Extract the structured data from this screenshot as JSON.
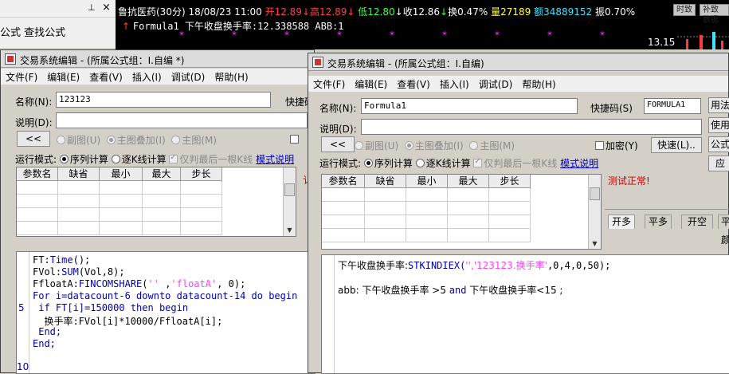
{
  "bg": {
    "menu_text": "公式 查找公式",
    "pin_icon": "pin-icon",
    "close_icon": "close-icon"
  },
  "stock": {
    "name_period": "鲁抗医药(30分)",
    "datetime": "18/08/23 11:00",
    "open": "开12.89",
    "high": "高12.89",
    "low": "低12.80",
    "close": "收12.86",
    "turnover": "换0.47%",
    "volume": "量27189",
    "amount": "额34889152",
    "amplitude": "振0.70%",
    "formula_line": "Formula1 下午收盘换手率:12.338588 ABB:1",
    "tag1": "时致",
    "tag2": "补致数据",
    "price_label": "13.15"
  },
  "left_window": {
    "title": "交易系统编辑 - (所属公式组：I.自编 *)",
    "menu": [
      "文件(F)",
      "编辑(E)",
      "查看(V)",
      "插入(I)",
      "调试(D)",
      "帮助(H)"
    ],
    "name_label": "名称(N):",
    "name_value": "123123",
    "shortcut_label": "快捷码",
    "desc_label": "说明(D):",
    "back_btn": "<<",
    "sub_chart": "副图(U)",
    "main_overlay": "主图叠加(I)",
    "main_chart": "主图(M)",
    "run_mode": "运行模式:",
    "seq_calc": "序列计算",
    "by_k_calc": "逐K线计算",
    "last_k_only": "仅判最后一根K线",
    "mode_help": "模式说明",
    "columns": [
      "参数名",
      "缺省",
      "最小",
      "最大",
      "步长"
    ],
    "code": [
      "FT:Time();",
      "FVol:SUM(Vol,8);",
      "FfloatA:FINCOMSHARE('' ,'floatA', 0);",
      "For i=datacount-6 downto datacount-14 do begin",
      " if FT[i]=150000 then begin",
      "  换手率:FVol[i]*10000/FfloatA[i];",
      " End;",
      "End;"
    ],
    "line_numbers": [
      "5",
      "10"
    ]
  },
  "right_window": {
    "title": "交易系统编辑 - (所属公式组：I.自编)",
    "menu": [
      "文件(F)",
      "编辑(E)",
      "查看(V)",
      "插入(I)",
      "调试(D)",
      "帮助(H)"
    ],
    "name_label": "名称(N):",
    "name_value": "Formula1",
    "shortcut_label": "快捷码(S)",
    "shortcut_value": "FORMULA1",
    "desc_label": "说明(D):",
    "back_btn": "<<",
    "sub_chart": "副图(U)",
    "main_overlay": "主图叠加(I)",
    "main_chart": "主图(M)",
    "encrypt": "加密(Y)",
    "quick_btn": "快速(L)..",
    "run_mode": "运行模式:",
    "seq_calc": "序列计算",
    "by_k_calc": "逐K线计算",
    "last_k_only": "仅判最后一根K线",
    "mode_help": "模式说明",
    "columns": [
      "参数名",
      "缺省",
      "最小",
      "最大",
      "步长"
    ],
    "test_status": "测试正常!",
    "tabs": [
      "开多",
      "平多",
      "开空",
      "平"
    ],
    "side_buttons": [
      "用法",
      "使用",
      "公式",
      "应"
    ],
    "code_line1_prefix": "下午收盘换手率:",
    "code_line1_func": "STKINDIEX(",
    "code_line1_args": "'','123123.换手率'",
    "code_line1_rest": ",0,4,0,50);",
    "code_line2_a": "abb: 下午收盘换手率 >5 ",
    "code_line2_and": "and",
    "code_line2_b": " 下午收盘换手率<15 ;",
    "tab_extra": "颜"
  }
}
